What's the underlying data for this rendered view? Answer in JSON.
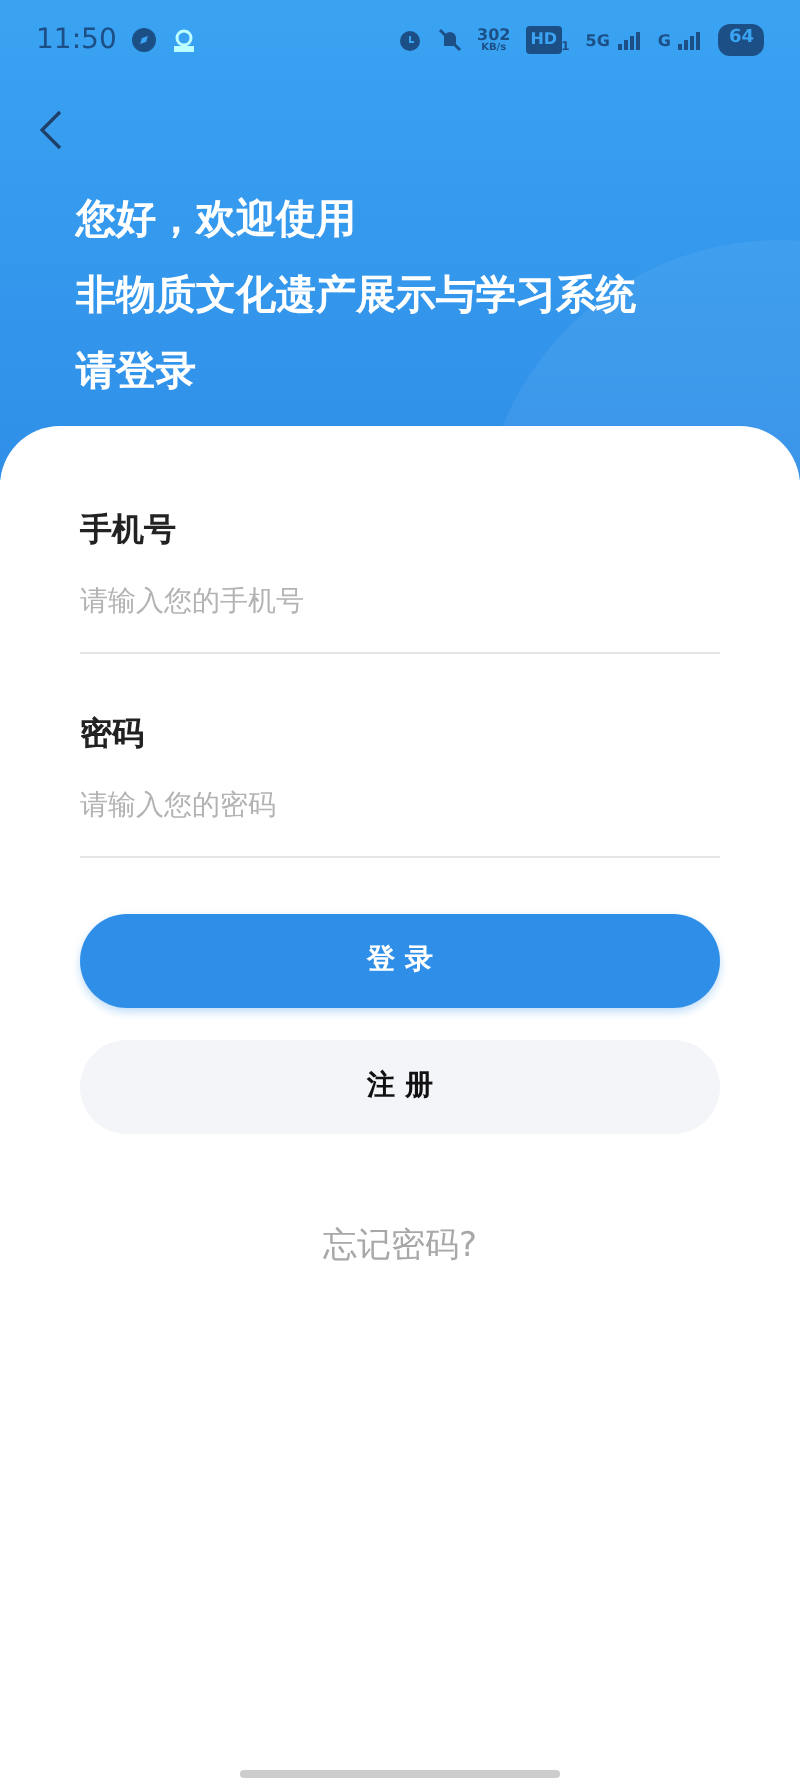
{
  "status_bar": {
    "time": "11:50",
    "speed": "302",
    "speed_unit": "KB/s",
    "hd": "HD",
    "hd_sub": "1",
    "network_5g": "5G",
    "network_g": "G",
    "battery": "64"
  },
  "greeting_lines": [
    "您好，欢迎使用",
    "非物质文化遗产展示与学习系统",
    "请登录"
  ],
  "fields": [
    {
      "label": "手机号",
      "placeholder": "请输入您的手机号"
    },
    {
      "label": "密码",
      "placeholder": "请输入您的密码"
    }
  ],
  "buttons": [
    {
      "label": "登 录",
      "kind": "primary"
    },
    {
      "label": "注 册",
      "kind": "secondary"
    }
  ],
  "forgot_link": "忘记密码?"
}
